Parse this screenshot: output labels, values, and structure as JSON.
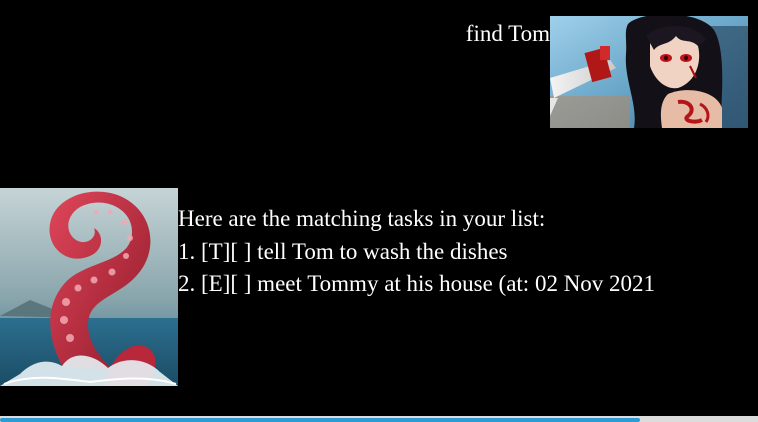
{
  "user_message": {
    "text": "find Tom",
    "avatar_icon": "anime-character-avatar"
  },
  "bot_message": {
    "avatar_icon": "kraken-tentacle-avatar",
    "lines": [
      "Here are the matching tasks in your list:",
      "1. [T][ ] tell Tom to wash the dishes",
      "2. [E][ ] meet Tommy at his house (at: 02 Nov 2021"
    ]
  },
  "colors": {
    "background": "#000000",
    "text": "#ffffff",
    "scroll_accent": "#2e9bd6"
  }
}
